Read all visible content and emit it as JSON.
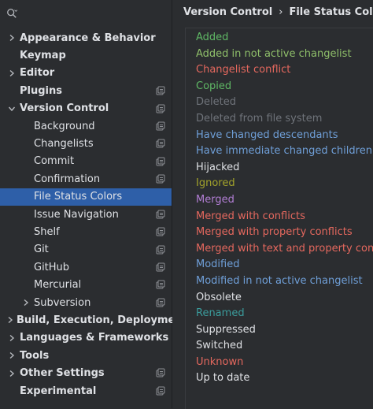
{
  "search": {
    "placeholder": ""
  },
  "sidebar": {
    "items": [
      {
        "label": "Appearance & Behavior",
        "chevron": "right",
        "bold": true,
        "indent": 0,
        "proj": false
      },
      {
        "label": "Keymap",
        "chevron": "",
        "bold": true,
        "indent": 0,
        "proj": false
      },
      {
        "label": "Editor",
        "chevron": "right",
        "bold": true,
        "indent": 0,
        "proj": false
      },
      {
        "label": "Plugins",
        "chevron": "",
        "bold": true,
        "indent": 0,
        "proj": true
      },
      {
        "label": "Version Control",
        "chevron": "down",
        "bold": true,
        "indent": 0,
        "proj": true
      },
      {
        "label": "Background",
        "chevron": "",
        "bold": false,
        "indent": 1,
        "proj": true
      },
      {
        "label": "Changelists",
        "chevron": "",
        "bold": false,
        "indent": 1,
        "proj": true
      },
      {
        "label": "Commit",
        "chevron": "",
        "bold": false,
        "indent": 1,
        "proj": true
      },
      {
        "label": "Confirmation",
        "chevron": "",
        "bold": false,
        "indent": 1,
        "proj": true
      },
      {
        "label": "File Status Colors",
        "chevron": "",
        "bold": false,
        "indent": 1,
        "proj": false,
        "selected": true
      },
      {
        "label": "Issue Navigation",
        "chevron": "",
        "bold": false,
        "indent": 1,
        "proj": true
      },
      {
        "label": "Shelf",
        "chevron": "",
        "bold": false,
        "indent": 1,
        "proj": true
      },
      {
        "label": "Git",
        "chevron": "",
        "bold": false,
        "indent": 1,
        "proj": true
      },
      {
        "label": "GitHub",
        "chevron": "",
        "bold": false,
        "indent": 1,
        "proj": true
      },
      {
        "label": "Mercurial",
        "chevron": "",
        "bold": false,
        "indent": 1,
        "proj": true
      },
      {
        "label": "Subversion",
        "chevron": "right",
        "bold": false,
        "indent": 1,
        "proj": true
      },
      {
        "label": "Build, Execution, Deployment",
        "chevron": "right",
        "bold": true,
        "indent": 0,
        "proj": false
      },
      {
        "label": "Languages & Frameworks",
        "chevron": "right",
        "bold": true,
        "indent": 0,
        "proj": false
      },
      {
        "label": "Tools",
        "chevron": "right",
        "bold": true,
        "indent": 0,
        "proj": false
      },
      {
        "label": "Other Settings",
        "chevron": "right",
        "bold": true,
        "indent": 0,
        "proj": true
      },
      {
        "label": "Experimental",
        "chevron": "",
        "bold": true,
        "indent": 0,
        "proj": true
      }
    ]
  },
  "header": {
    "breadcrumb": [
      "Version Control",
      "File Status Colors"
    ],
    "separator": "›"
  },
  "statuses": [
    {
      "label": "Added",
      "color": "#5fb865"
    },
    {
      "label": "Added in not active changelist",
      "color": "#8fbf6a"
    },
    {
      "label": "Changelist conflict",
      "color": "#e5685e"
    },
    {
      "label": "Copied",
      "color": "#5fb865"
    },
    {
      "label": "Deleted",
      "color": "#6f737a"
    },
    {
      "label": "Deleted from file system",
      "color": "#6f737a"
    },
    {
      "label": "Have changed descendants",
      "color": "#6f9fd8"
    },
    {
      "label": "Have immediate changed children",
      "color": "#6f9fd8"
    },
    {
      "label": "Hijacked",
      "color": "#dfe1e5"
    },
    {
      "label": "Ignored",
      "color": "#a3a32b"
    },
    {
      "label": "Merged",
      "color": "#b27ed4"
    },
    {
      "label": "Merged with conflicts",
      "color": "#e5685e"
    },
    {
      "label": "Merged with property conflicts",
      "color": "#e5685e"
    },
    {
      "label": "Merged with text and property con...",
      "color": "#e5685e"
    },
    {
      "label": "Modified",
      "color": "#6f9fd8"
    },
    {
      "label": "Modified in not active changelist",
      "color": "#6f9fd8"
    },
    {
      "label": "Obsolete",
      "color": "#dfe1e5"
    },
    {
      "label": "Renamed",
      "color": "#3b9c9c"
    },
    {
      "label": "Suppressed",
      "color": "#dfe1e5"
    },
    {
      "label": "Switched",
      "color": "#dfe1e5"
    },
    {
      "label": "Unknown",
      "color": "#e5685e"
    },
    {
      "label": "Up to date",
      "color": "#dfe1e5"
    }
  ],
  "colors": {
    "selection": "#2e5fa8",
    "background": "#2b2d30",
    "text": "#dfe1e5"
  }
}
